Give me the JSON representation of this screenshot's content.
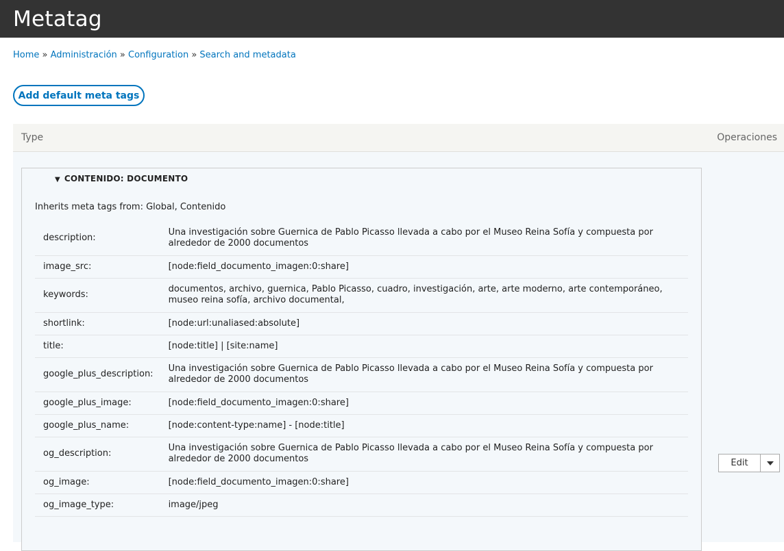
{
  "header": {
    "title": "Metatag"
  },
  "breadcrumb": {
    "home": "Home",
    "sep": " » ",
    "admin": "Administración",
    "config": "Configuration",
    "search": "Search and metadata"
  },
  "actions": {
    "add_label": "Add default meta tags"
  },
  "table": {
    "col_type": "Type",
    "col_ops": "Operaciones"
  },
  "group": {
    "title": "CONTENIDO: DOCUMENTO",
    "inherits": "Inherits meta tags from: Global, Contenido",
    "rows": [
      {
        "key": "description:",
        "value": "Una investigación sobre Guernica de Pablo Picasso llevada a cabo por el Museo Reina Sofía y compuesta por alrededor de 2000 documentos"
      },
      {
        "key": "image_src:",
        "value": "[node:field_documento_imagen:0:share]"
      },
      {
        "key": "keywords:",
        "value": "documentos, archivo, guernica, Pablo Picasso, cuadro, investigación, arte, arte moderno, arte contemporáneo, museo reina sofía, archivo documental,"
      },
      {
        "key": "shortlink:",
        "value": "[node:url:unaliased:absolute]"
      },
      {
        "key": "title:",
        "value": "[node:title] | [site:name]"
      },
      {
        "key": "google_plus_description:",
        "value": "Una investigación sobre Guernica de Pablo Picasso llevada a cabo por el Museo Reina Sofía y compuesta por alrededor de 2000 documentos"
      },
      {
        "key": "google_plus_image:",
        "value": "[node:field_documento_imagen:0:share]"
      },
      {
        "key": "google_plus_name:",
        "value": "[node:content-type:name] - [node:title]"
      },
      {
        "key": "og_description:",
        "value": "Una investigación sobre Guernica de Pablo Picasso llevada a cabo por el Museo Reina Sofía y compuesta por alrededor de 2000 documentos"
      },
      {
        "key": "og_image:",
        "value": "[node:field_documento_imagen:0:share]"
      },
      {
        "key": "og_image_type:",
        "value": "image/jpeg"
      }
    ]
  },
  "operations": {
    "edit_label": "Edit"
  }
}
